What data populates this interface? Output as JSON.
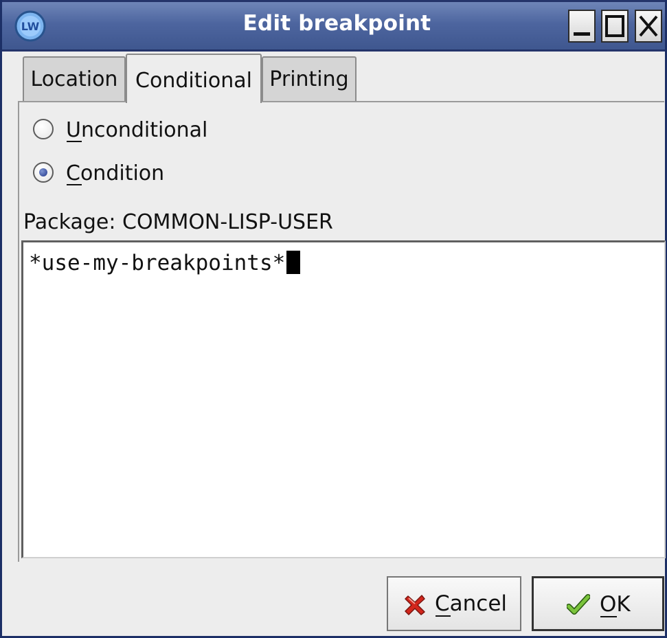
{
  "window": {
    "title": "Edit breakpoint",
    "app_icon": "lispworks-logo-icon",
    "controls": {
      "minimize": "minimize-icon",
      "maximize": "maximize-icon",
      "close": "close-icon"
    }
  },
  "tabs": [
    {
      "label": "Location",
      "active": false
    },
    {
      "label": "Conditional",
      "active": true
    },
    {
      "label": "Printing",
      "active": false
    }
  ],
  "conditional": {
    "options": [
      {
        "label": "Unconditional",
        "selected": false
      },
      {
        "label": "Condition",
        "selected": true
      }
    ],
    "package_label": "Package: COMMON-LISP-USER",
    "editor_value": "*use-my-breakpoints*"
  },
  "buttons": {
    "cancel": {
      "label": "Cancel",
      "icon": "red-x-icon"
    },
    "ok": {
      "label": "OK",
      "icon": "checkmark-icon"
    }
  },
  "colors": {
    "titlebar": "#4d659f",
    "window_bg": "#ededed",
    "selected_radio": "#20368a"
  }
}
